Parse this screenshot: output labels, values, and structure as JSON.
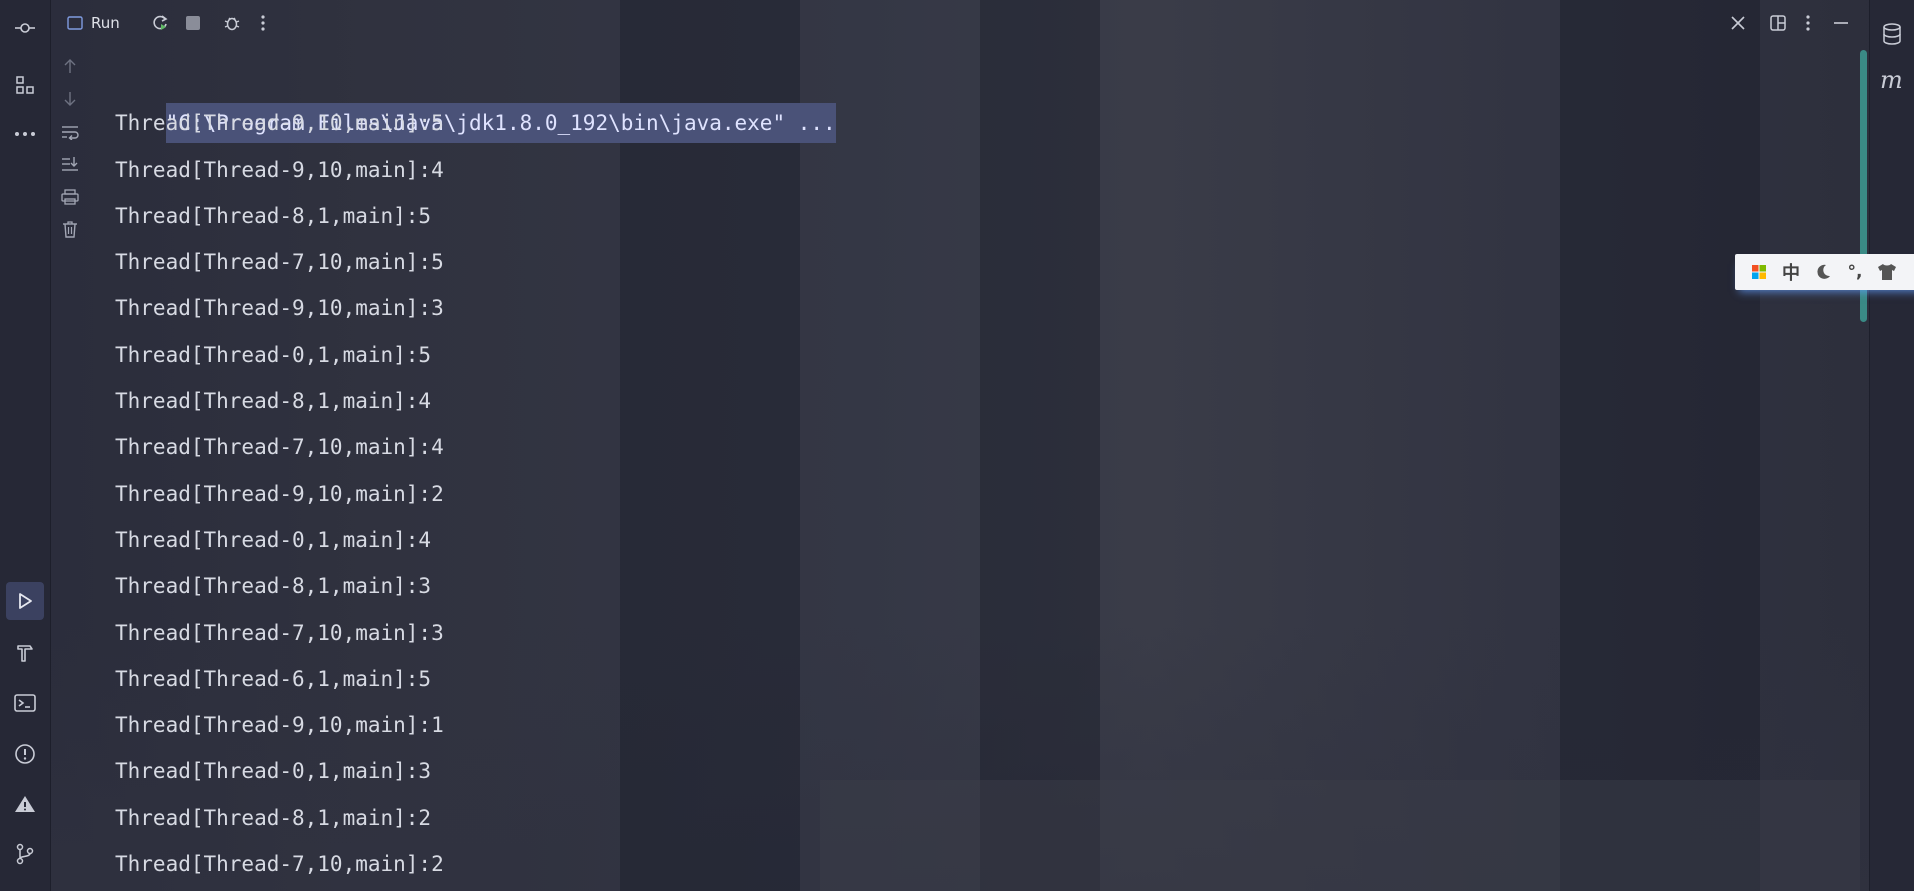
{
  "toolbar": {
    "run_label": "Run"
  },
  "console": {
    "command": "\"C:\\Program Files\\Java\\jdk1.8.0_192\\bin\\java.exe\" ...",
    "lines": [
      "Thread[Thread-9,10,main]:5",
      "Thread[Thread-9,10,main]:4",
      "Thread[Thread-8,1,main]:5",
      "Thread[Thread-7,10,main]:5",
      "Thread[Thread-9,10,main]:3",
      "Thread[Thread-0,1,main]:5",
      "Thread[Thread-8,1,main]:4",
      "Thread[Thread-7,10,main]:4",
      "Thread[Thread-9,10,main]:2",
      "Thread[Thread-0,1,main]:4",
      "Thread[Thread-8,1,main]:3",
      "Thread[Thread-7,10,main]:3",
      "Thread[Thread-6,1,main]:5",
      "Thread[Thread-9,10,main]:1",
      "Thread[Thread-0,1,main]:3",
      "Thread[Thread-8,1,main]:2",
      "Thread[Thread-7,10,main]:2"
    ]
  },
  "right_rail": {
    "maven_label": "m"
  },
  "ime": {
    "chinese_label": "中",
    "punct_label": "°,"
  },
  "colors": {
    "accent_selection": "#4a5278",
    "scrollbar": "#3a8a85",
    "text": "#d7dae3"
  }
}
